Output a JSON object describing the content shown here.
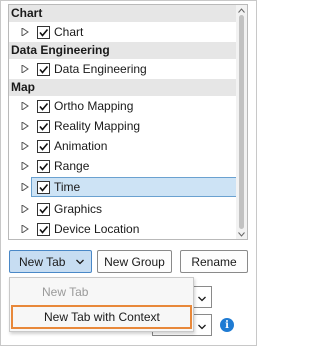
{
  "tree": {
    "groups": [
      {
        "header": "Chart",
        "items": [
          {
            "label": "Chart",
            "checked": true,
            "selected": false
          }
        ]
      },
      {
        "header": "Data Engineering",
        "items": [
          {
            "label": "Data Engineering",
            "checked": true,
            "selected": false
          }
        ]
      },
      {
        "header": "Map",
        "items": [
          {
            "label": "Ortho Mapping",
            "checked": true,
            "selected": false
          },
          {
            "label": "Reality Mapping",
            "checked": true,
            "selected": false
          },
          {
            "label": "Animation",
            "checked": true,
            "selected": false
          },
          {
            "label": "Range",
            "checked": true,
            "selected": false
          },
          {
            "label": "Time",
            "checked": true,
            "selected": true
          },
          {
            "label": "Graphics",
            "checked": true,
            "selected": false
          },
          {
            "label": "Device Location",
            "checked": true,
            "selected": false
          }
        ]
      }
    ]
  },
  "buttons": {
    "new_tab": "New Tab",
    "new_group": "New Group",
    "rename": "Rename"
  },
  "menu": {
    "items": [
      {
        "label": "New Tab",
        "enabled": false
      },
      {
        "label": "New Tab with Context",
        "enabled": true,
        "highlighted": true
      }
    ]
  },
  "info_glyph": "i",
  "colors": {
    "selection": "#cde3f5",
    "highlight_border": "#e8883a",
    "accent_button": "#c7ddf2",
    "info": "#1f7bd3"
  }
}
